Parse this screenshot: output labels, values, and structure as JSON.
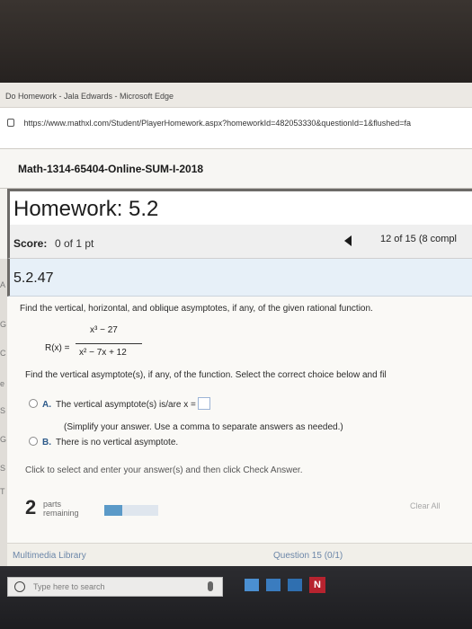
{
  "window": {
    "title": "Do Homework - Jala Edwards - Microsoft Edge",
    "url": "https://www.mathxl.com/Student/PlayerHomework.aspx?homeworkId=482053330&questionId=1&flushed=fa"
  },
  "course": {
    "name": "Math-1314-65404-Online-SUM-I-2018"
  },
  "homework": {
    "title": "Homework: 5.2"
  },
  "score": {
    "label": "Score:",
    "value": "0 of 1 pt"
  },
  "question_nav": {
    "position": "12 of 15 (8 compl"
  },
  "problem": {
    "number": "5.2.47",
    "instruction": "Find the vertical, horizontal, and oblique asymptotes, if any, of the given rational function.",
    "function_name": "R(x) =",
    "numerator": "x³ − 27",
    "denominator": "x² − 7x + 12",
    "sub_instruction": "Find the vertical asymptote(s), if any, of the function. Select the correct choice below and fil",
    "choices": [
      {
        "letter": "A.",
        "text": "The vertical asymptote(s) is/are x ="
      },
      {
        "letter": "B.",
        "text": "There is no vertical asymptote."
      }
    ],
    "choice_a_hint": "(Simplify your answer. Use a comma to separate answers as needed.)",
    "help_message": "Click to select and enter your answer(s) and then click Check Answer."
  },
  "progress": {
    "parts_count": "2",
    "parts_label": "parts",
    "remaining_label": "remaining",
    "fraction_complete": 0.33,
    "accent_color": "#5b9ac8"
  },
  "actions": {
    "clear_all": "Clear All"
  },
  "footer": {
    "media_library": "Multimedia Library",
    "question_status": "Question 15 (0/1)"
  },
  "left_edge_letters": [
    "A",
    "G",
    "C",
    "e",
    "S",
    "G",
    "S",
    "T"
  ],
  "taskbar": {
    "search_placeholder": "Type here to search",
    "app_badge": "N"
  }
}
